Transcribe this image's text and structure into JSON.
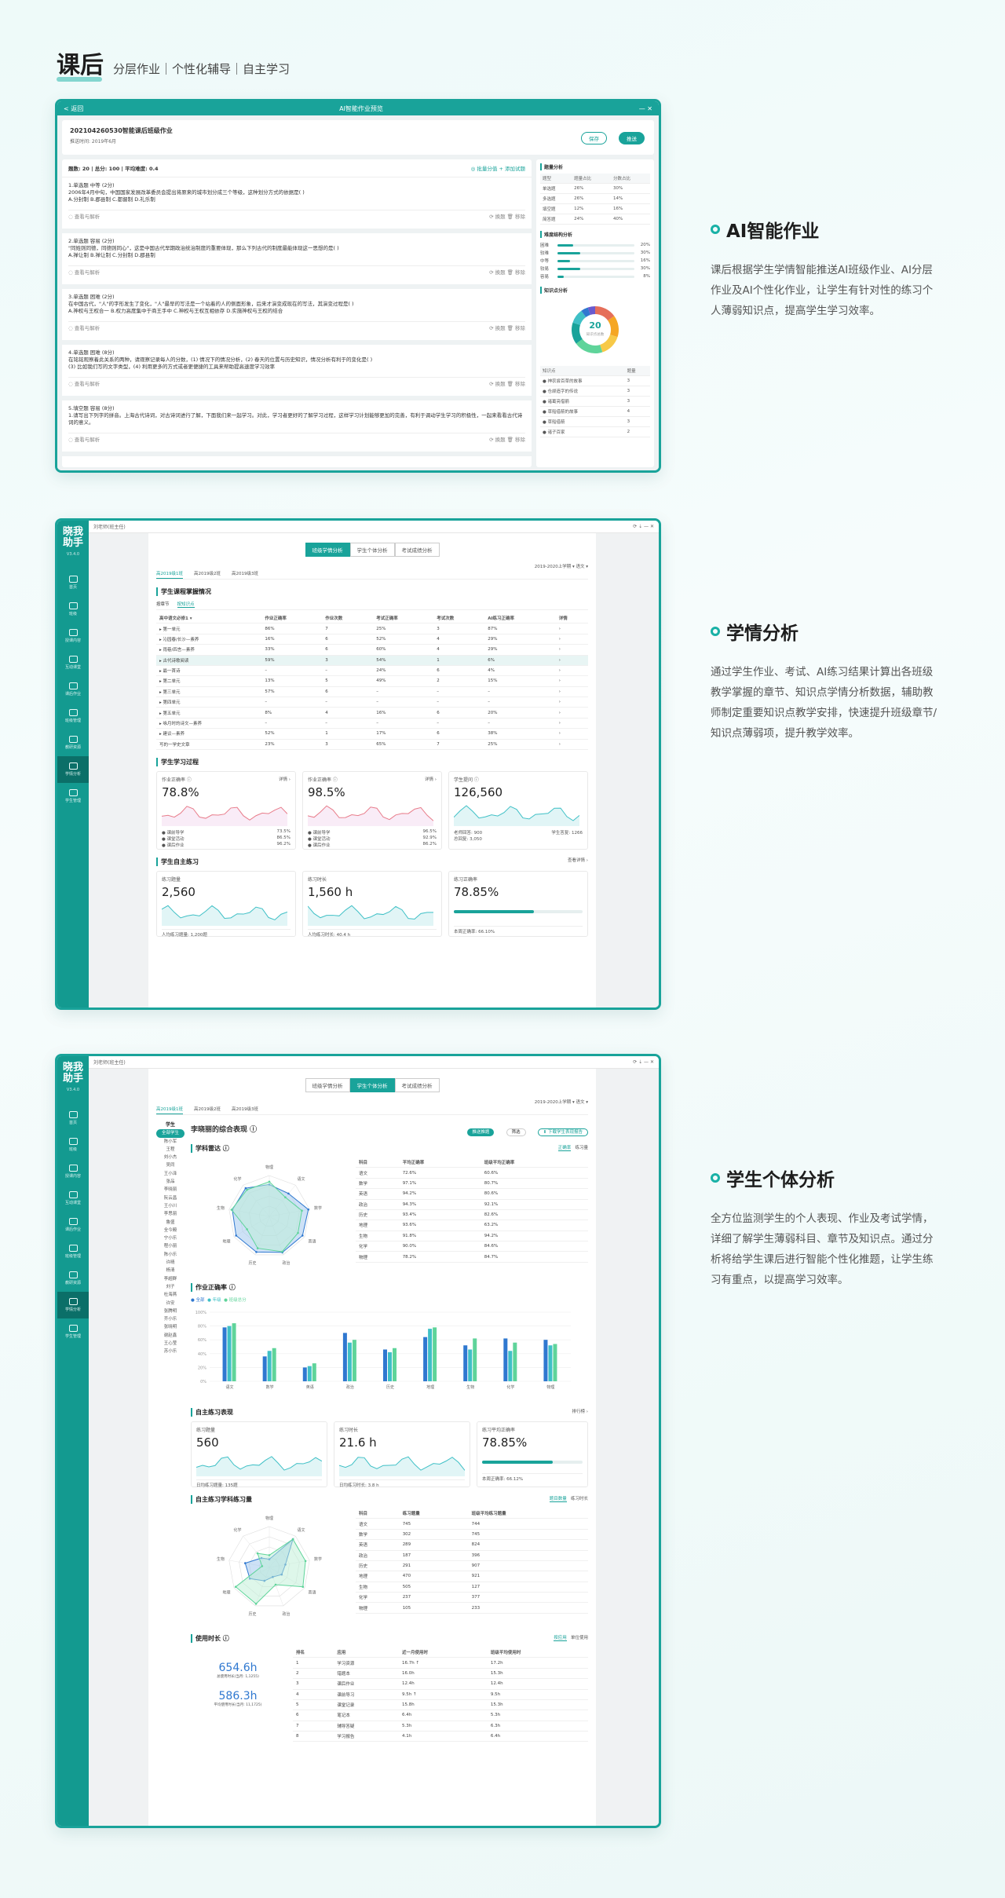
{
  "header": {
    "title": "课后",
    "subtitle": "分层作业｜个性化辅导｜自主学习"
  },
  "features": [
    {
      "title": "AI智能作业",
      "desc": "课后根据学生学情智能推送AI班级作业、AI分层作业及AI个性化作业，让学生有针对性的练习个人薄弱知识点，提高学生学习效率。"
    },
    {
      "title": "学情分析",
      "desc": "通过学生作业、考试、AI练习结果计算出各班级教学掌握的章节、知识点学情分析数据，辅助教师制定重要知识点教学安排，快速提升班级章节/知识点薄弱项，提升教学效率。"
    },
    {
      "title": "学生个体分析",
      "desc": "全方位监测学生的个人表现、作业及考试学情，详细了解学生薄弱科目、章节及知识点。通过分析将给学生课后进行智能个性化推题，让学生练习有重点，以提高学习效率。"
    }
  ],
  "hw": {
    "back": "< 返回",
    "window_title": "AI智能作业预览",
    "win_ctrls": "—  ✕",
    "name": "202104260530智能课后班级作业",
    "meta": "推送时间: 2019年6月",
    "save": "保存",
    "push": "推送",
    "stats": "题数: 20  |  总分: 100  |  平均难度: 0.4",
    "actions": "◎ 批量分值   + 添加试题",
    "questions": [
      {
        "h": "1.单选题 中等 (2分)",
        "t": "2006年4月中旬，中国国家发展改革委员会提出将原来的城市划分成三个等级，这种划分方式的依据是(  )",
        "o": "A.分封制   B.郡县制   C.都督制   D.礼乐制"
      },
      {
        "h": "2.单选题 容易 (2分)",
        "t": "\"同姓则同德，同德则同心\"，这是中国古代早期政治统治制度的重要体现，那么下列古代的制度最能体现这一思想的是(  )",
        "o": "A.禅让制   B.禅让制   C.分封制   D.郡县制"
      },
      {
        "h": "3.单选题 困难 (2分)",
        "t": "在中国古代，\"人\"的字形发生了变化，\"人\"最早的写法是一个站着的人的侧面形象，后来才演变成现在的写法，其演变过程是(  )",
        "o": "A.神权与王权合一   B.权力高度集中于商王手中   C.神权与王权互相依存   D.实施神权与王权的结合"
      },
      {
        "h": "4.单选题 困难 (8分)",
        "t": "在铭铭观察着此关系的两种，请观察记录每人的分数，(1) 情况下的情况分析，(2) 春天的位置与历史知识，情况分析有利于的变化是(  )",
        "o": "(3) 比如我们写的文字类型，(4) 利用更多的方式或者更便捷的工具来帮助提高速度学习效率"
      },
      {
        "h": "5.填空题 容易 (8分)",
        "t": "1.请写出下列字的拼音。上海古代诗词，对古诗词进行了解，下面我们来一起学习。对此，学习者更好的了解学习过程，这样学习计划能够更加的完善，有利于调动学生学习的积极性，一起来看看古代诗词的意义。",
        "o": ""
      }
    ],
    "qfoot_left": "◌ 查看与解析",
    "qfoot_right": "⟳ 换题   🗑 移除",
    "p1_title": "题量分析",
    "p1_head": [
      "题型",
      "题量占比",
      "分数占比"
    ],
    "p1_rows": [
      [
        "单选题",
        "26%",
        "30%"
      ],
      [
        "多选题",
        "26%",
        "14%"
      ],
      [
        "填空题",
        "12%",
        "16%"
      ],
      [
        "简答题",
        "24%",
        "40%"
      ]
    ],
    "p2_title": "难度结构分析",
    "p2_rows": [
      {
        "l": "困难",
        "v": 0.2,
        "t": "20%"
      },
      {
        "l": "较难",
        "v": 0.3,
        "t": "30%"
      },
      {
        "l": "中等",
        "v": 0.16,
        "t": "16%"
      },
      {
        "l": "较易",
        "v": 0.3,
        "t": "30%"
      },
      {
        "l": "容易",
        "v": 0.08,
        "t": "8%"
      }
    ],
    "p3_title": "知识点分析",
    "donut_num": "20",
    "donut_lab": "知识点总数",
    "p3_head": [
      "知识点",
      "题量"
    ],
    "p3_rows": [
      [
        "● 神农尝百草的故事",
        "3"
      ],
      [
        "● 仓颉造字的传说",
        "3"
      ],
      [
        "● 诸葛亮借箭",
        "3"
      ],
      [
        "● 草船借箭的故事",
        "4"
      ],
      [
        "● 草船借箭",
        "3"
      ],
      [
        "● 诸子百家",
        "2"
      ]
    ]
  },
  "xq": {
    "logo": "晓我",
    "logo2": "助手",
    "ver": "V3.4.0",
    "nav": [
      "首页",
      "班级",
      "授课内容",
      "互动课堂",
      "课后作业",
      "班级管理",
      "教研资源",
      "学情分析",
      "学生管理"
    ],
    "user": "刘老师(班主任)",
    "tabs": [
      "班级学情分析",
      "学生个体分析",
      "考试成绩分析"
    ],
    "classes": [
      "高2019级1班",
      "高2019级2班",
      "高2019级3班"
    ],
    "term": "2019-2020上学期 ▾   语文 ▾",
    "s1": "学生课程掌握情况",
    "s1tabs": [
      "按章节",
      "按知识点"
    ],
    "head": [
      "高中语文必修1 ▾",
      "作业正确率",
      "作业次数",
      "考试正确率",
      "考试次数",
      "AI练习正确率",
      "详情"
    ],
    "rows": [
      [
        "▸ 第一单元",
        "86%",
        "7",
        "25%",
        "3",
        "87%",
        "›"
      ],
      [
        "   ▸ 沁园春/长沙—素养",
        "16%",
        "6",
        "52%",
        "4",
        "29%",
        "›"
      ],
      [
        "   ▸ 雨巷/四言—素养",
        "33%",
        "6",
        "60%",
        "4",
        "29%",
        "›"
      ],
      [
        "   ▸ 古代诗歌阅读",
        "59%",
        "3",
        "54%",
        "1",
        "6%",
        "›"
      ],
      [
        "      ▸ 最一首诗",
        "–",
        "–",
        "24%",
        "6",
        "4%",
        "›"
      ],
      [
        "▸ 第二单元",
        "13%",
        "5",
        "49%",
        "2",
        "15%",
        "›"
      ],
      [
        "▸ 第三单元",
        "57%",
        "6",
        "–",
        "–",
        "–",
        "›"
      ],
      [
        "▸ 第四单元",
        "–",
        "–",
        "–",
        "–",
        "–",
        "›"
      ],
      [
        "▸ 第五单元",
        "8%",
        "4",
        "16%",
        "6",
        "20%",
        "›"
      ],
      [
        "   ▸ 咏月时的诗文—素养",
        "–",
        "–",
        "–",
        "–",
        "–",
        "›"
      ],
      [
        "      ▸ 建议—素养",
        "52%",
        "1",
        "17%",
        "6",
        "38%",
        "›"
      ],
      [
        "         写的一学史文章",
        "23%",
        "3",
        "65%",
        "7",
        "25%",
        "›"
      ]
    ],
    "s2": "学生学习过程",
    "k2": [
      {
        "lab": "作业正确率 ⓘ",
        "val": "78.8%",
        "d": "详情 ›",
        "leg": [
          [
            "● 课前导学",
            "73.5%"
          ],
          [
            "● 课堂活动",
            "86.5%"
          ],
          [
            "● 课后作业",
            "96.2%"
          ]
        ]
      },
      {
        "lab": "作业正确率 ⓘ",
        "val": "98.5%",
        "d": "详情 ›",
        "leg": [
          [
            "● 课前导学",
            "96.5%"
          ],
          [
            "● 课堂活动",
            "92.9%"
          ],
          [
            "● 课后作业",
            "86.2%"
          ]
        ]
      },
      {
        "lab": "学生提问 ⓘ",
        "val": "126,560",
        "d": "",
        "leg": [
          [
            "老师回答: 900",
            "学生答复: 1266"
          ],
          [
            "总回复: 3,050",
            ""
          ]
        ]
      }
    ],
    "s3": "学生自主练习",
    "s3more": "查看详情 ›",
    "k3": [
      {
        "lab": "练习题量",
        "val": "2,560",
        "f": "人均练习题量: 1,200题"
      },
      {
        "lab": "练习时长",
        "val": "1,560 h",
        "f": "人均练习时长: 40.4 h"
      },
      {
        "lab": "练习正确率",
        "val": "78.85%",
        "f": "本周正确率: 66.10%"
      }
    ]
  },
  "gr": {
    "title": "李晓丽的综合表现 ⓘ",
    "b1": "推送推题",
    "b2": "筛选",
    "b3": "⬇ 下载学生表现报告",
    "students_head": "学生",
    "students": [
      "全部学生",
      "陈小军",
      "王程",
      "刘小杰",
      "吴同",
      "王小泽",
      "张品",
      "李晓丽",
      "阮云昌",
      "王小川",
      "李思丽",
      "鲁盛",
      "全今殿",
      "宁小乐",
      "程小丽",
      "陈小乐",
      "许晴",
      "杨清",
      "李超群",
      "刘子",
      "杜海燕",
      "许安",
      "张腾明",
      "齐小乐",
      "张晓明",
      "谢赵鑫",
      "王心莹",
      "苏小乐"
    ],
    "radar_s": "学科雷达 ⓘ",
    "radar_tabs": [
      "正确率",
      "练习量"
    ],
    "subjects": [
      "物理",
      "语文",
      "数学",
      "英语",
      "政治",
      "历史",
      "地理",
      "生物",
      "化学"
    ],
    "subj_head": [
      "科目",
      "平均正确率",
      "班级平均正确率"
    ],
    "subj_rows": [
      [
        "语文",
        "72.6%",
        "60.6%"
      ],
      [
        "数学",
        "97.1%",
        "80.7%"
      ],
      [
        "英语",
        "94.2%",
        "80.6%"
      ],
      [
        "政治",
        "94.3%",
        "92.1%"
      ],
      [
        "历史",
        "93.4%",
        "82.6%"
      ],
      [
        "地理",
        "93.6%",
        "63.2%"
      ],
      [
        "生物",
        "91.8%",
        "94.2%"
      ],
      [
        "化学",
        "90.0%",
        "84.6%"
      ],
      [
        "物理",
        "78.2%",
        "84.7%"
      ]
    ],
    "bar_s": "作业正确率 ⓘ",
    "bar_leg": [
      "● 全部",
      "● 年级",
      "● 班级总分"
    ],
    "prac_s": "自主练习表现",
    "prac_more": "排行榜 ›",
    "pk": [
      {
        "lab": "练习题量",
        "val": "560",
        "f": "日均练习题量: 135题"
      },
      {
        "lab": "练习时长",
        "val": "21.6 h",
        "f": "日均练习时长: 3.8 h"
      },
      {
        "lab": "练习平均正确率",
        "val": "78.85%",
        "f": "本周正确率: 66.12%"
      }
    ],
    "pr_s": "自主练习学科练习量",
    "pr_tabs": [
      "题目数量",
      "练习时长"
    ],
    "pr_head": [
      "科目",
      "练习题量",
      "班级平均练习题量"
    ],
    "pr_rows": [
      [
        "语文",
        "745",
        "744"
      ],
      [
        "数学",
        "302",
        "745"
      ],
      [
        "英语",
        "289",
        "824"
      ],
      [
        "政治",
        "187",
        "396"
      ],
      [
        "历史",
        "291",
        "907"
      ],
      [
        "地理",
        "470",
        "921"
      ],
      [
        "生物",
        "505",
        "127"
      ],
      [
        "化学",
        "237",
        "377"
      ],
      [
        "物理",
        "105",
        "233"
      ]
    ],
    "use_s": "使用时长 ⓘ",
    "use_tabs": [
      "按应用",
      "单位使用"
    ],
    "use_big1": "654.6h",
    "use_lab1": "总使用时长(当月: 1,1255)",
    "use_big2": "586.3h",
    "use_lab2": "平均使用时长(当月: 11,1725)",
    "use_head": [
      "排名",
      "应用",
      "近一月使用时",
      "班级平均使用时"
    ],
    "use_rows": [
      [
        "1",
        "学习资源",
        "16.7h ↑",
        "17.2h"
      ],
      [
        "2",
        "错题本",
        "16.0h",
        "15.3h"
      ],
      [
        "3",
        "课后作业",
        "12.4h",
        "12.4h"
      ],
      [
        "4",
        "课前导习",
        "9.5h ↑",
        "9.5h"
      ],
      [
        "5",
        "课堂记录",
        "15.8h",
        "15.3h"
      ],
      [
        "6",
        "笔记本",
        "6.4h",
        "5.3h"
      ],
      [
        "7",
        "辅导答疑",
        "5.3h",
        "6.3h"
      ],
      [
        "8",
        "学习报告",
        "4.1h",
        "6.4h"
      ]
    ]
  },
  "chart_data": [
    {
      "type": "bar",
      "title": "作业正确率",
      "categories": [
        "语文",
        "数学",
        "英语",
        "政治",
        "历史",
        "地理",
        "生物",
        "化学",
        "物理"
      ],
      "ylim": [
        0,
        100
      ],
      "series": [
        {
          "name": "全部",
          "values": [
            78,
            36,
            20,
            70,
            46,
            64,
            52,
            62,
            60
          ]
        },
        {
          "name": "年级",
          "values": [
            80,
            44,
            22,
            56,
            42,
            76,
            46,
            44,
            52
          ]
        },
        {
          "name": "班级总分",
          "values": [
            84,
            48,
            26,
            60,
            48,
            78,
            62,
            56,
            54
          ]
        }
      ]
    }
  ],
  "colors": {
    "teal": "#19a39a",
    "teal_dark": "#0b6f68",
    "blue": "#2f78d0",
    "green": "#5fd49a",
    "cyan": "#3fc0c6"
  }
}
